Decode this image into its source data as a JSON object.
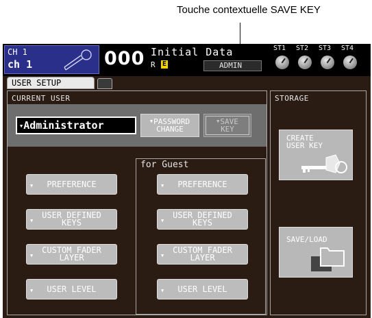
{
  "callout": {
    "label": "Touche contextuelle SAVE KEY"
  },
  "status_bar": {
    "ch_number": "CH 1",
    "ch_name": "ch 1",
    "scene_number": "000",
    "scene_title": "Initial Data",
    "scene_r": "R",
    "scene_e": "E",
    "user_badge": "ADMIN",
    "st_labels": [
      "ST1",
      "ST2",
      "ST3",
      "ST4"
    ]
  },
  "tab": {
    "label": "USER SETUP"
  },
  "current_user": {
    "title": "CURRENT USER",
    "selected_user": "Administrator",
    "password_change": {
      "line1": "PASSWORD",
      "line2": "CHANGE"
    },
    "save_key": {
      "line1": "SAVE",
      "line2": "KEY"
    },
    "guest_title": "for Guest",
    "buttons": {
      "preference": "PREFERENCE",
      "user_defined_1": "USER DEFINED",
      "user_defined_2": "KEYS",
      "custom_fader_1": "CUSTOM FADER",
      "custom_fader_2": "LAYER",
      "user_level": "USER LEVEL"
    }
  },
  "storage": {
    "title": "STORAGE",
    "create_key": {
      "line1": "CREATE",
      "line2": "USER KEY"
    },
    "save_load": "SAVE/LOAD"
  }
}
